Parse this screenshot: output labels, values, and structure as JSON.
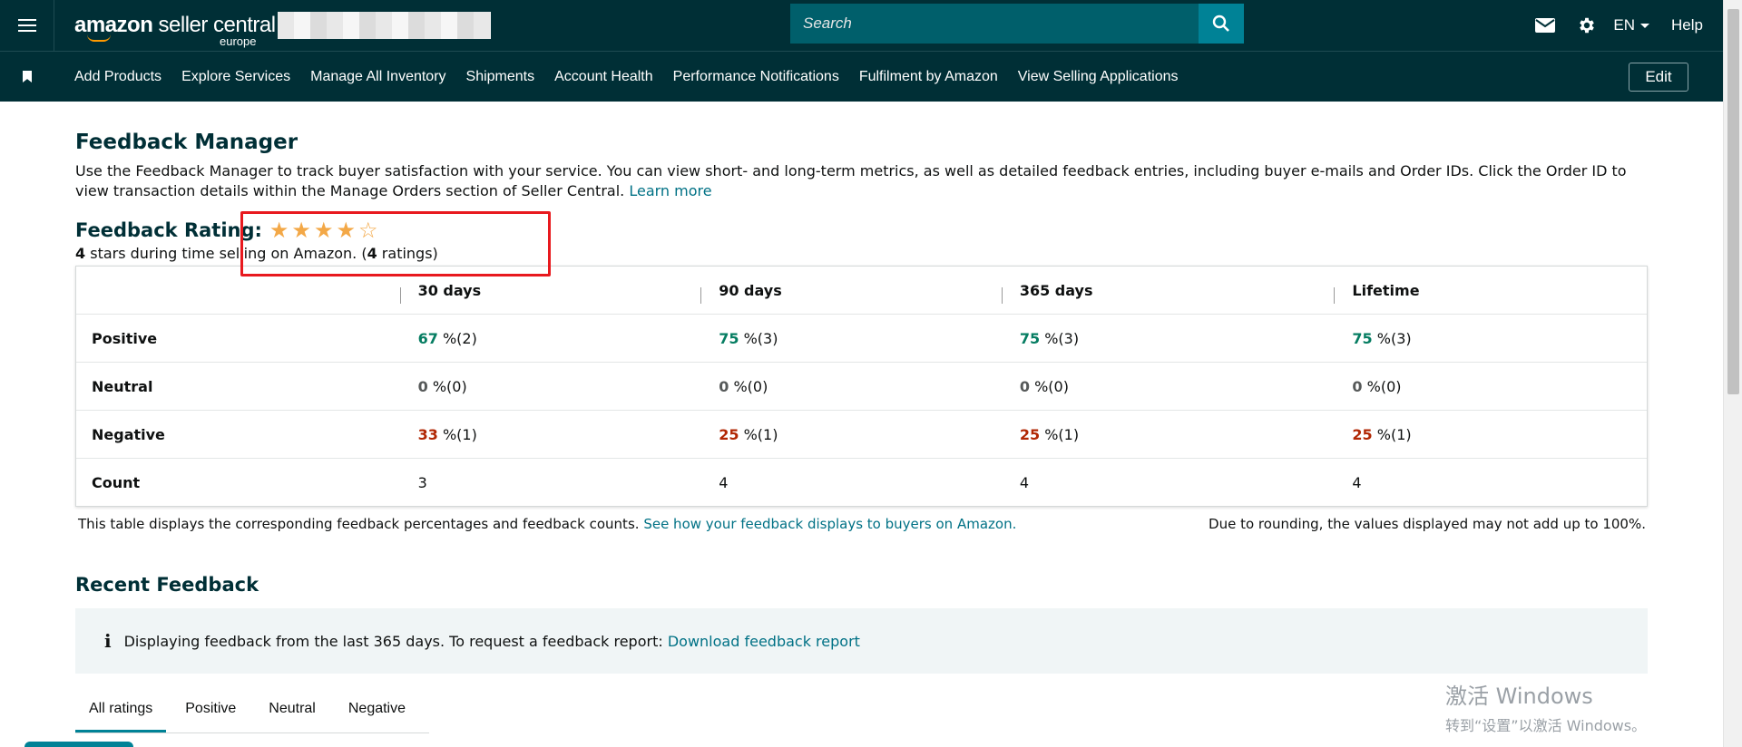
{
  "header": {
    "logo_main": "amazon",
    "logo_rest": " seller central",
    "logo_region": "europe",
    "search_placeholder": "Search",
    "language": "EN",
    "help": "Help"
  },
  "nav": {
    "items": [
      "Add Products",
      "Explore Services",
      "Manage All Inventory",
      "Shipments",
      "Account Health",
      "Performance Notifications",
      "Fulfilment by Amazon",
      "View Selling Applications"
    ],
    "edit_label": "Edit"
  },
  "page": {
    "title": "Feedback Manager",
    "intro": "Use the Feedback Manager to track buyer satisfaction with your service. You can view short- and long-term metrics, as well as detailed feedback entries, including buyer e-mails and Order IDs. Click the Order ID to view transaction details within the Manage Orders section of Seller Central.",
    "learn_more": "Learn more",
    "rating_label": "Feedback Rating:",
    "rating_stars": 4,
    "rating_max": 5,
    "rating_stars_text": "4",
    "rating_sub_mid": " stars during time selling on Amazon. (",
    "rating_count": "4",
    "rating_sub_end": " ratings)"
  },
  "table": {
    "headers": [
      "30 days",
      "90 days",
      "365 days",
      "Lifetime"
    ],
    "rows": {
      "positive": {
        "label": "Positive",
        "values": [
          "67",
          "75",
          "75",
          "75"
        ],
        "counts": [
          "%(2)",
          "%(3)",
          "%(3)",
          "%(3)"
        ]
      },
      "neutral": {
        "label": "Neutral",
        "values": [
          "0",
          "0",
          "0",
          "0"
        ],
        "counts": [
          "%(0)",
          "%(0)",
          "%(0)",
          "%(0)"
        ]
      },
      "negative": {
        "label": "Negative",
        "values": [
          "33",
          "25",
          "25",
          "25"
        ],
        "counts": [
          "%(1)",
          "%(1)",
          "%(1)",
          "%(1)"
        ]
      },
      "count": {
        "label": "Count",
        "values": [
          "3",
          "4",
          "4",
          "4"
        ]
      }
    },
    "note_left": "This table displays the corresponding feedback percentages and feedback counts.",
    "note_link": "See how your feedback displays to buyers on Amazon.",
    "note_right": "Due to rounding, the values displayed may not add up to 100%."
  },
  "recent": {
    "title": "Recent Feedback",
    "info_text": "Displaying feedback from the last 365 days. To request a feedback report:",
    "info_link": "Download feedback report",
    "tabs": [
      "All ratings",
      "Positive",
      "Neutral",
      "Negative"
    ]
  },
  "watermark": {
    "line1": "激活 Windows",
    "line2": "转到“设置”以激活 Windows。"
  },
  "colors": {
    "header_bg": "#002f36",
    "search_bg": "#005f6b",
    "accent": "#008296",
    "positive": "#067d62",
    "negative": "#b12704",
    "highlight": "#e8191e",
    "star": "#f3a847"
  }
}
